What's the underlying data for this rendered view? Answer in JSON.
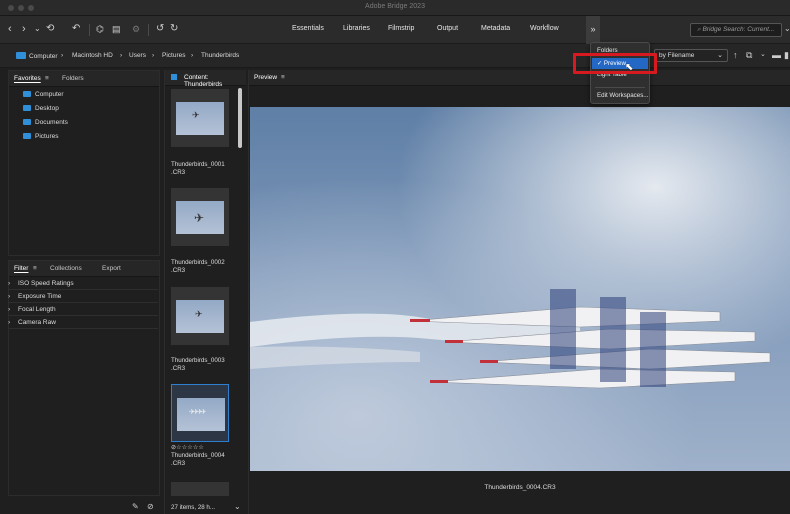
{
  "window": {
    "title": "Adobe Bridge 2023"
  },
  "toolbar": {
    "workspaces": [
      "Essentials",
      "Libraries",
      "Filmstrip",
      "Output",
      "Metadata",
      "Workflow"
    ],
    "more_label": "»",
    "search_placeholder": "Bridge Search: Current..."
  },
  "path": {
    "crumbs": [
      "Computer",
      "Macintosh HD",
      "Users",
      "Pictures",
      "Thunderbirds"
    ],
    "sort_label": "by Filename"
  },
  "workspace_menu": {
    "items": [
      "Folders",
      "Preview",
      "Light Table",
      "Edit Workspaces..."
    ],
    "checked": "Preview"
  },
  "favorites_panel": {
    "tabs": [
      "Favorites",
      "Folders"
    ],
    "items": [
      "Computer",
      "Desktop",
      "Documents",
      "Pictures"
    ]
  },
  "filter_panel": {
    "tabs": [
      "Filter",
      "Collections",
      "Export"
    ],
    "rows": [
      "ISO Speed Ratings",
      "Exposure Time",
      "Focal Length",
      "Camera Raw"
    ]
  },
  "content_panel": {
    "title": "Content: Thunderbirds",
    "items": [
      {
        "name": "Thunderbirds_0001",
        "ext": ".CR3"
      },
      {
        "name": "Thunderbirds_0002",
        "ext": ".CR3"
      },
      {
        "name": "Thunderbirds_0003",
        "ext": ".CR3"
      },
      {
        "name": "Thunderbirds_0004",
        "ext": ".CR3",
        "rating": "⊘☆☆☆☆☆"
      }
    ],
    "status": "27 items, 28 h..."
  },
  "preview_panel": {
    "title": "Preview",
    "caption": "Thunderbirds_0004.CR3"
  },
  "colors": {
    "accent": "#2468c6",
    "folder": "#2f8fd8",
    "highlight": "#d71920"
  }
}
